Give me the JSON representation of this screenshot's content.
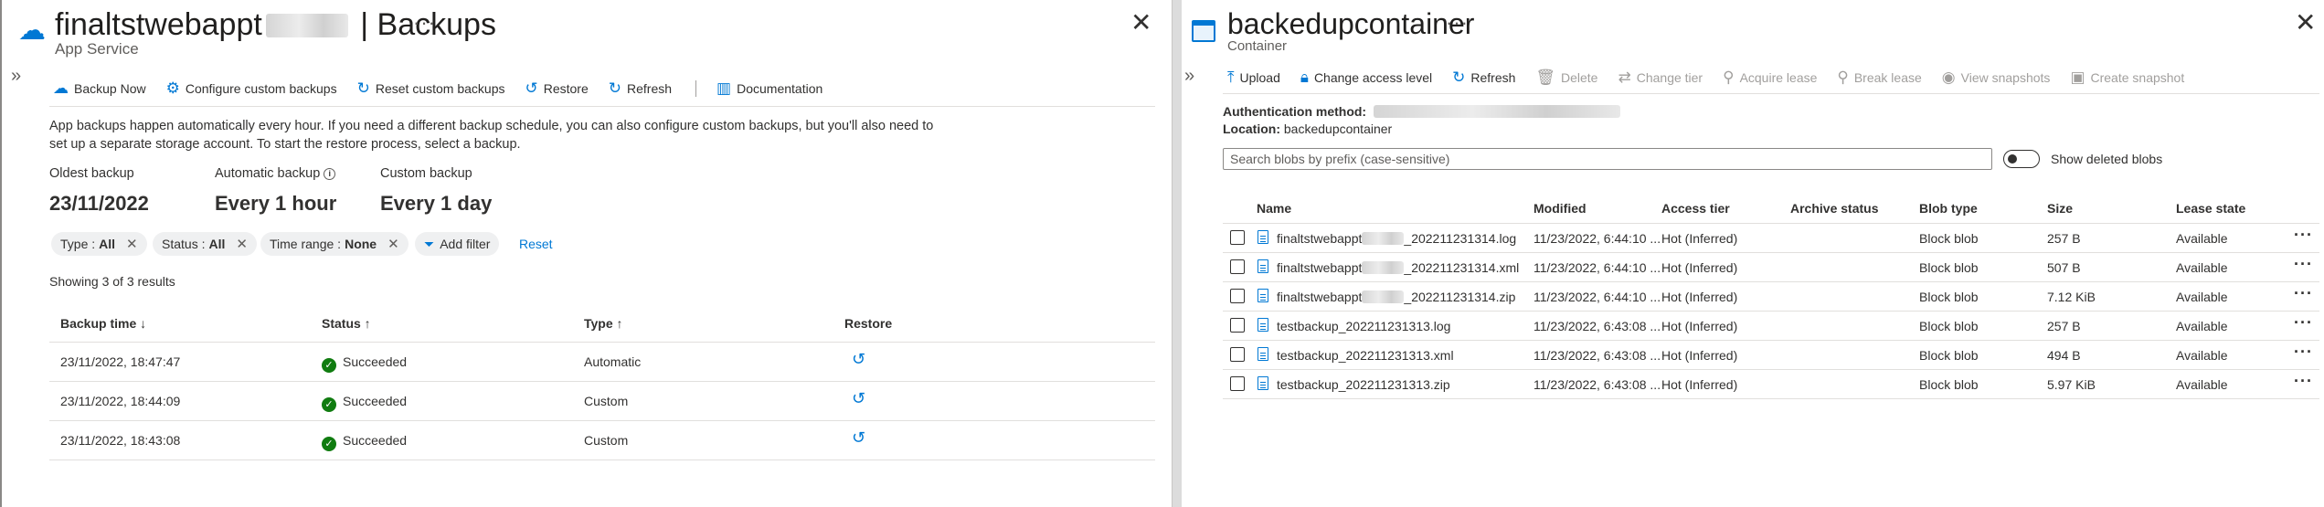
{
  "left": {
    "title_prefix": "finaltstwebappt",
    "title_suffix": "| Backups",
    "subtitle": "App Service",
    "toolbar": [
      {
        "icon": "cloud-arrow-icon",
        "glyph": "☁",
        "label": "Backup Now"
      },
      {
        "icon": "gear-icon",
        "glyph": "⚙",
        "label": "Configure custom backups"
      },
      {
        "icon": "reset-icon",
        "glyph": "↻",
        "label": "Reset custom backups"
      },
      {
        "icon": "restore-icon",
        "glyph": "↺",
        "label": "Restore"
      },
      {
        "icon": "refresh-icon",
        "glyph": "↻",
        "label": "Refresh"
      },
      {
        "icon": "book-icon",
        "glyph": "▥",
        "label": "Documentation"
      }
    ],
    "description_line1": "App backups happen automatically every hour. If you need a different backup schedule, you can also configure custom backups, but you'll also need to",
    "description_line2": "set up a separate storage account. To start the restore process, select a backup.",
    "stats": {
      "oldest_label": "Oldest backup",
      "oldest_value": "23/11/2022",
      "automatic_label": "Automatic backup",
      "automatic_value": "Every 1 hour",
      "custom_label": "Custom backup",
      "custom_value": "Every 1 day"
    },
    "filters": {
      "type_label": "Type :",
      "type_value": "All",
      "status_label": "Status :",
      "status_value": "All",
      "time_label": "Time range :",
      "time_value": "None",
      "add_filter": "Add filter",
      "reset": "Reset"
    },
    "results_text": "Showing 3 of 3 results",
    "columns": [
      "Backup time ↓",
      "Status ↑",
      "Type ↑",
      "Restore"
    ],
    "rows": [
      {
        "time": "23/11/2022, 18:47:47",
        "status": "Succeeded",
        "type": "Automatic"
      },
      {
        "time": "23/11/2022, 18:44:09",
        "status": "Succeeded",
        "type": "Custom"
      },
      {
        "time": "23/11/2022, 18:43:08",
        "status": "Succeeded",
        "type": "Custom"
      }
    ]
  },
  "right": {
    "title": "backedupcontainer",
    "subtitle": "Container",
    "toolbar": [
      {
        "icon": "upload-icon",
        "glyph": "⤒",
        "label": "Upload",
        "enabled": true
      },
      {
        "icon": "lock-icon",
        "glyph": "🔒︎",
        "label": "Change access level",
        "enabled": true
      },
      {
        "icon": "refresh-icon",
        "glyph": "↻",
        "label": "Refresh",
        "enabled": true
      },
      {
        "icon": "delete-icon",
        "glyph": "🗑︎",
        "label": "Delete",
        "enabled": false
      },
      {
        "icon": "change-tier-icon",
        "glyph": "⇄",
        "label": "Change tier",
        "enabled": false
      },
      {
        "icon": "acquire-lease-icon",
        "glyph": "⚲",
        "label": "Acquire lease",
        "enabled": false
      },
      {
        "icon": "break-lease-icon",
        "glyph": "⚲",
        "label": "Break lease",
        "enabled": false
      },
      {
        "icon": "view-snapshots-icon",
        "glyph": "◉",
        "label": "View snapshots",
        "enabled": false
      },
      {
        "icon": "create-snapshot-icon",
        "glyph": "▣",
        "label": "Create snapshot",
        "enabled": false
      }
    ],
    "auth_label": "Authentication method:",
    "location_label": "Location:",
    "location_value": "backedupcontainer",
    "search_placeholder": "Search blobs by prefix (case-sensitive)",
    "show_deleted_label": "Show deleted blobs",
    "columns": [
      "Name",
      "Modified",
      "Access tier",
      "Archive status",
      "Blob type",
      "Size",
      "Lease state"
    ],
    "blobs": [
      {
        "name_prefix": "finaltstwebappt",
        "name_suffix": "_202211231314.log",
        "redacted": true,
        "modified": "11/23/2022, 6:44:10 ...",
        "tier": "Hot (Inferred)",
        "archive": "",
        "type": "Block blob",
        "size": "257 B",
        "lease": "Available"
      },
      {
        "name_prefix": "finaltstwebappt",
        "name_suffix": "_202211231314.xml",
        "redacted": true,
        "modified": "11/23/2022, 6:44:10 ...",
        "tier": "Hot (Inferred)",
        "archive": "",
        "type": "Block blob",
        "size": "507 B",
        "lease": "Available"
      },
      {
        "name_prefix": "finaltstwebappt",
        "name_suffix": "_202211231314.zip",
        "redacted": true,
        "modified": "11/23/2022, 6:44:10 ...",
        "tier": "Hot (Inferred)",
        "archive": "",
        "type": "Block blob",
        "size": "7.12 KiB",
        "lease": "Available"
      },
      {
        "name_prefix": "testbackup_202211231313.log",
        "name_suffix": "",
        "redacted": false,
        "modified": "11/23/2022, 6:43:08 ...",
        "tier": "Hot (Inferred)",
        "archive": "",
        "type": "Block blob",
        "size": "257 B",
        "lease": "Available"
      },
      {
        "name_prefix": "testbackup_202211231313.xml",
        "name_suffix": "",
        "redacted": false,
        "modified": "11/23/2022, 6:43:08 ...",
        "tier": "Hot (Inferred)",
        "archive": "",
        "type": "Block blob",
        "size": "494 B",
        "lease": "Available"
      },
      {
        "name_prefix": "testbackup_202211231313.zip",
        "name_suffix": "",
        "redacted": false,
        "modified": "11/23/2022, 6:43:08 ...",
        "tier": "Hot (Inferred)",
        "archive": "",
        "type": "Block blob",
        "size": "5.97 KiB",
        "lease": "Available"
      }
    ]
  }
}
